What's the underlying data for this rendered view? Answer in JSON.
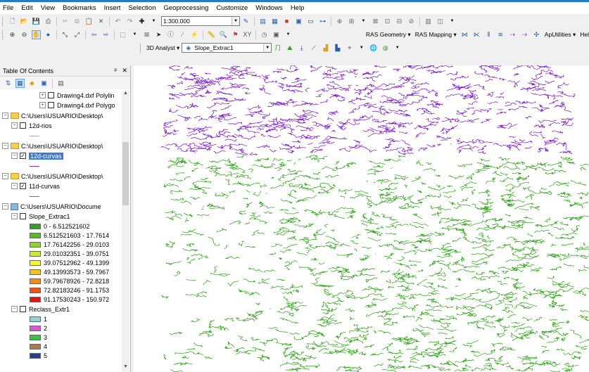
{
  "menu": [
    "File",
    "Edit",
    "View",
    "Bookmarks",
    "Insert",
    "Selection",
    "Geoprocessing",
    "Customize",
    "Windows",
    "Help"
  ],
  "toolbar": {
    "scale_value": "1:300.000",
    "ras_geometry": "RAS Geometry",
    "ras_mapping": "RAS Mapping",
    "ap_utilities": "ApUtilities",
    "help_cut": "Hel",
    "analyst_3d": "3D Analyst",
    "layer_combo": "Slope_Extrac1"
  },
  "toc": {
    "title": "Table Of Contents",
    "close_glyph": "✕",
    "pin_glyph": "ₐ",
    "rows": [
      {
        "label": "Drawing4.dxf Polylin",
        "type": "layer",
        "indent": 1,
        "checked": false
      },
      {
        "label": "Drawing4.dxf Polygo",
        "type": "layer",
        "indent": 1,
        "checked": false
      },
      {
        "label": "C:\\Users\\USUARIO\\Desktop\\",
        "type": "folder"
      },
      {
        "label": "12d-rios",
        "type": "layer",
        "indent": 0,
        "checked": false
      },
      {
        "label": "C:\\Users\\USUARIO\\Desktop\\",
        "type": "folder"
      },
      {
        "label": "12d-curvas",
        "type": "layer",
        "indent": 0,
        "checked": true,
        "selected": true
      },
      {
        "label": "C:\\Users\\USUARIO\\Desktop\\",
        "type": "folder"
      },
      {
        "label": "11d-curvas",
        "type": "layer",
        "indent": 0,
        "checked": true
      },
      {
        "label": "C:\\Users\\USUARIO\\Docume",
        "type": "db"
      },
      {
        "label": "Slope_Extrac1",
        "type": "layer",
        "indent": 0,
        "checked": false
      },
      {
        "label": "Reclass_Extr1",
        "type": "layer",
        "indent": 0,
        "checked": false
      }
    ],
    "slope_classes": [
      {
        "label": "0 - 6.512521602",
        "color": "#3a9a2e"
      },
      {
        "label": "6.512521603 - 17.7614",
        "color": "#5ab92d"
      },
      {
        "label": "17.76142256 - 29.0103",
        "color": "#8ed62b"
      },
      {
        "label": "29.01032351 - 39.0751",
        "color": "#c8ec2f"
      },
      {
        "label": "39.07512962 - 49.1399",
        "color": "#f8f52f"
      },
      {
        "label": "49.13993573 - 59.7967",
        "color": "#f7c31e"
      },
      {
        "label": "59.79678926 - 72.8218",
        "color": "#f48c1a"
      },
      {
        "label": "72.82183246 - 91.1753",
        "color": "#ef5416"
      },
      {
        "label": "91.17530243 - 150.972",
        "color": "#e41414"
      }
    ],
    "reclass_classes": [
      {
        "label": "1",
        "color": "#8fd3d6"
      },
      {
        "label": "2",
        "color": "#d65ad6"
      },
      {
        "label": "3",
        "color": "#3ec13e"
      },
      {
        "label": "4",
        "color": "#a87c4a"
      },
      {
        "label": "5",
        "color": "#2b3d8f"
      }
    ]
  },
  "colors": {
    "contour_purple": "#7a18c9",
    "contour_green": "#2ea018",
    "river": "#ffffff",
    "selection": "#3b7bd4"
  }
}
